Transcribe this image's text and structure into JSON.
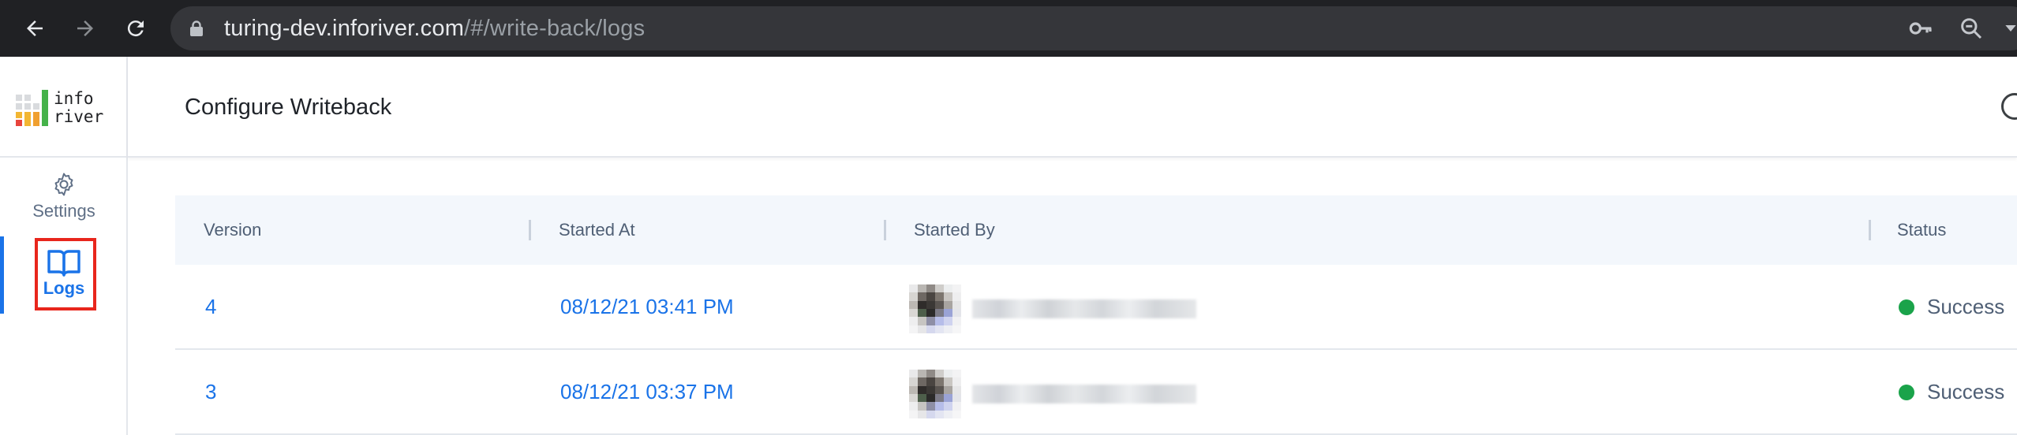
{
  "browser": {
    "url_host": "turing-dev.inforiver.com",
    "url_path": "/#/write-back/logs",
    "icons": [
      "back-arrow-icon",
      "forward-arrow-icon",
      "reload-icon",
      "lock-icon",
      "key-icon",
      "zoom-icon"
    ]
  },
  "logo": {
    "line1": "info",
    "line2": "river"
  },
  "nav": {
    "settings_label": "Settings",
    "logs_label": "Logs"
  },
  "header": {
    "title": "Configure Writeback"
  },
  "table": {
    "columns": [
      "Version",
      "Started At",
      "Started By",
      "Status"
    ],
    "rows": [
      {
        "version": "4",
        "started_at": "08/12/21 03:41 PM",
        "status": "Success"
      },
      {
        "version": "3",
        "started_at": "08/12/21 03:37 PM",
        "status": "Success"
      }
    ]
  },
  "colors": {
    "accent": "#1a73e8",
    "success": "#1aa34a",
    "highlight": "#e8261c",
    "chrome_bg": "#202124",
    "table_header_bg": "#f3f7fc"
  }
}
